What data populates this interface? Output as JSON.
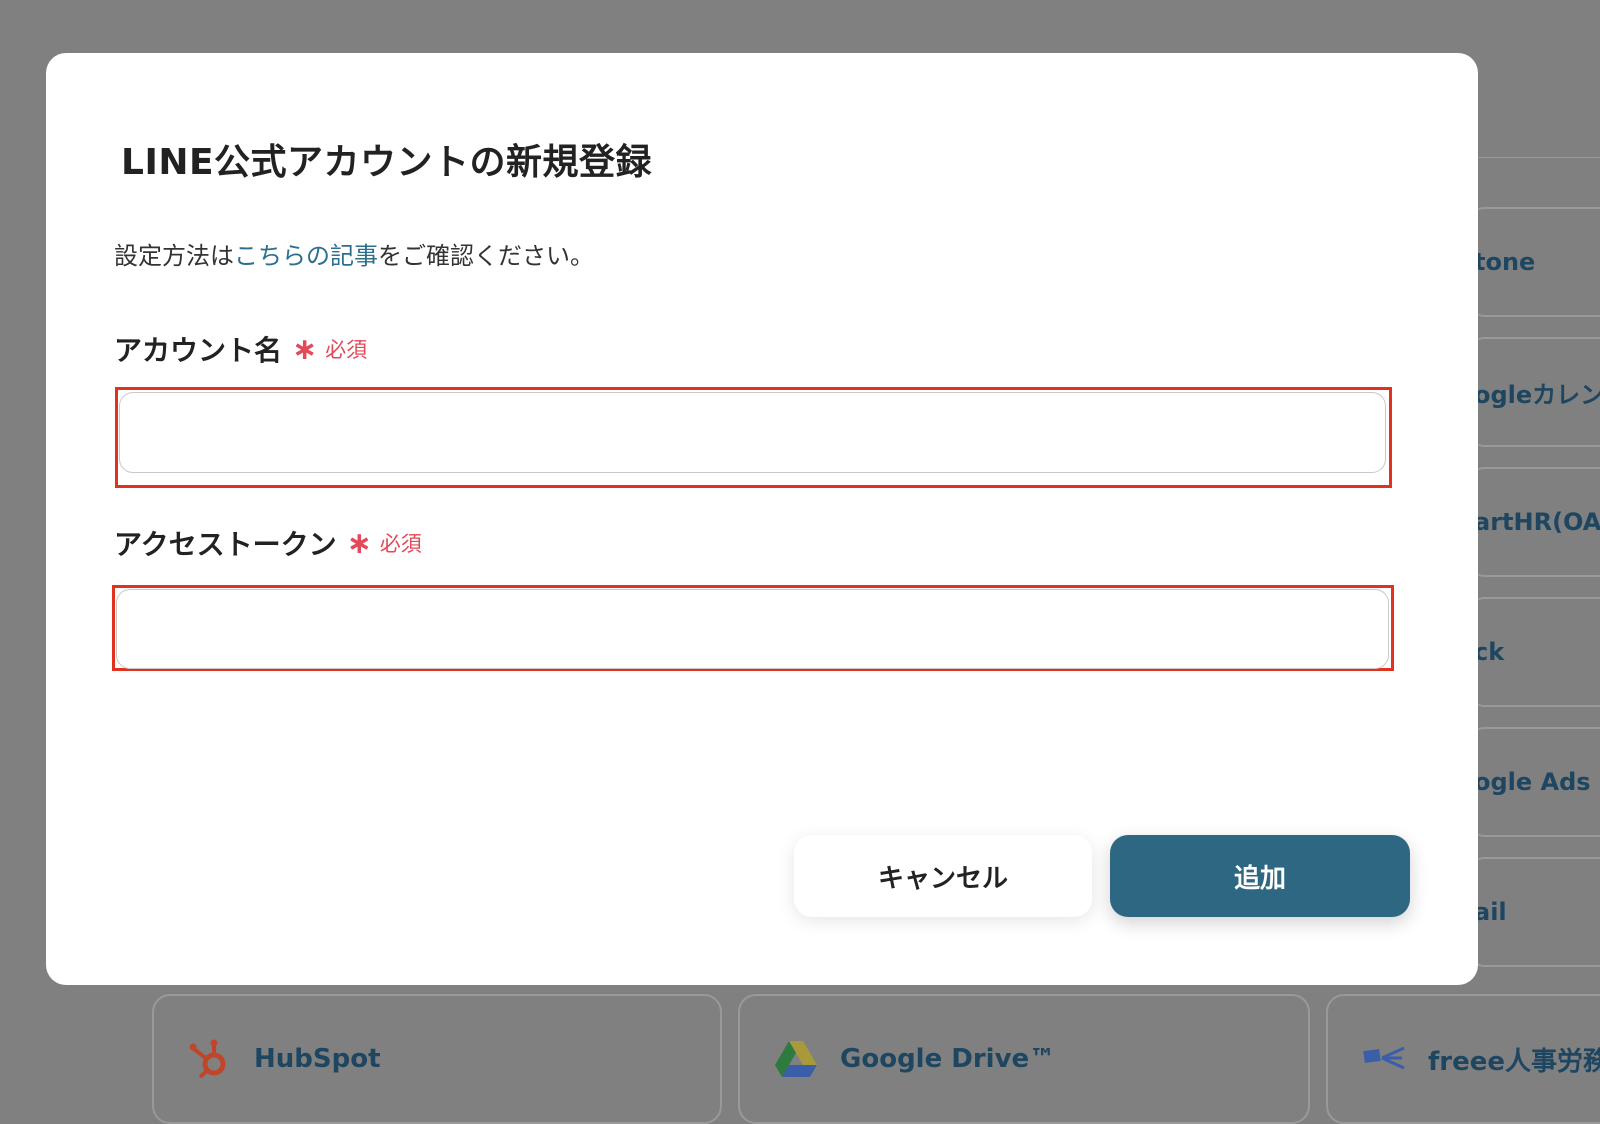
{
  "modal": {
    "title": "LINE公式アカウントの新規登録",
    "desc_prefix": "設定方法は",
    "desc_link": "こちらの記事",
    "desc_suffix": "をご確認ください。",
    "fields": [
      {
        "label": "アカウント名",
        "star": "∗",
        "required": "必須",
        "value": "",
        "placeholder": ""
      },
      {
        "label": "アクセストークン",
        "star": "∗",
        "required": "必須",
        "value": "",
        "placeholder": ""
      }
    ],
    "cancel_label": "キャンセル",
    "add_label": "追加"
  },
  "background": {
    "side_items": [
      "tone",
      "ogleカレン",
      "artHR(OA",
      "ck",
      "ogle Ads",
      "ail"
    ],
    "bottom_items": [
      {
        "label": "HubSpot",
        "icon": "hubspot-icon"
      },
      {
        "label": "Google Drive™",
        "icon": "google-drive-icon"
      },
      {
        "label": "freee人事労務",
        "icon": "freee-icon"
      }
    ]
  },
  "colors": {
    "primary": "#2e6782",
    "required": "#e24a5a",
    "highlight": "#e0331f",
    "link": "#2d6f8e",
    "overlay": "#808080"
  }
}
